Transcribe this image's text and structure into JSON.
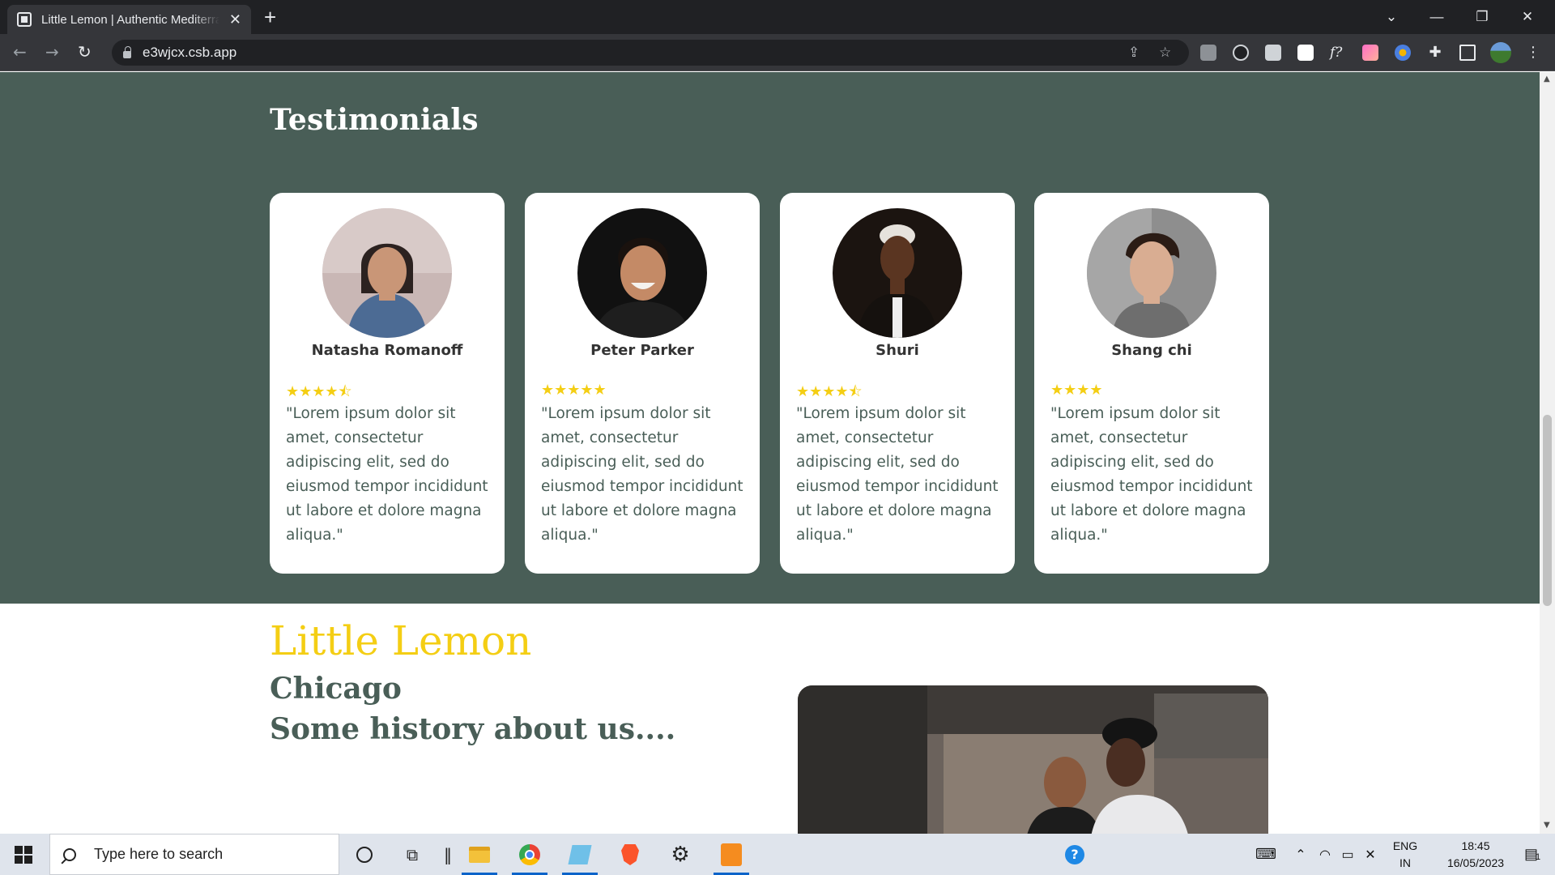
{
  "browser": {
    "tab_title": "Little Lemon | Authentic Mediterranean",
    "tab_close": "✕",
    "new_tab": "+",
    "url": "e3wjcx.csb.app",
    "window_controls": [
      "⌄",
      "—",
      "❐",
      "✕"
    ]
  },
  "testimonials": {
    "title": "Testimonials",
    "cards": [
      {
        "name": "Natasha Romanoff",
        "rating": 4.5,
        "stars": "★★★★⯪",
        "quote": "\"Lorem ipsum dolor sit amet, consectetur adipiscing elit, sed do eiusmod tempor incididunt ut labore et dolore magna aliqua.\""
      },
      {
        "name": "Peter Parker",
        "rating": 5,
        "stars": "★★★★★",
        "quote": "\"Lorem ipsum dolor sit amet, consectetur adipiscing elit, sed do eiusmod tempor incididunt ut labore et dolore magna aliqua.\""
      },
      {
        "name": "Shuri",
        "rating": 4.5,
        "stars": "★★★★⯪",
        "quote": "\"Lorem ipsum dolor sit amet, consectetur adipiscing elit, sed do eiusmod tempor incididunt ut labore et dolore magna aliqua.\""
      },
      {
        "name": "Shang chi",
        "rating": 4,
        "stars": "★★★★",
        "quote": "\"Lorem ipsum dolor sit amet, consectetur adipiscing elit, sed do eiusmod tempor incididunt ut labore et dolore magna aliqua.\""
      }
    ]
  },
  "about": {
    "title": "Little Lemon",
    "city": "Chicago",
    "history": "Some history about us...."
  },
  "taskbar": {
    "search_placeholder": "Type here to search",
    "language": "ENG",
    "region": "IN",
    "time": "18:45",
    "date": "16/05/2023",
    "notification_count": "1"
  },
  "colors": {
    "primary_green": "#495e57",
    "primary_yellow": "#f4ce14"
  }
}
